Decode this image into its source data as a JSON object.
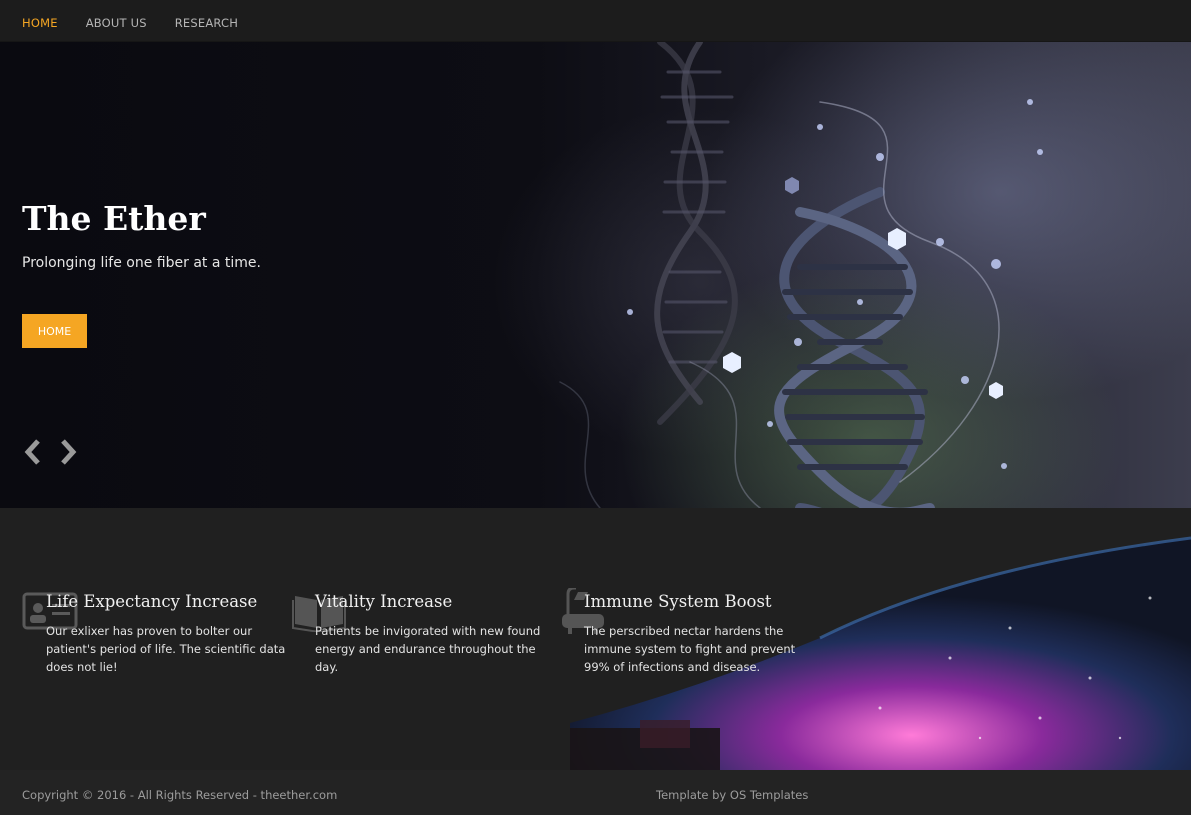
{
  "nav": {
    "items": [
      {
        "label": "HOME"
      },
      {
        "label": "ABOUT US"
      },
      {
        "label": "RESEARCH"
      }
    ]
  },
  "hero": {
    "title": "The Ether",
    "subtitle": "Prolonging life one fiber at a time.",
    "button_label": "HOME",
    "prev_icon": "chevron-left-icon",
    "next_icon": "chevron-right-icon"
  },
  "features": [
    {
      "icon": "id-card-icon",
      "title": "Life Expectancy Increase",
      "text": "Our exlixer has proven to bolter our patient's period of life. The scientific data does not lie!"
    },
    {
      "icon": "open-book-icon",
      "title": "Vitality Increase",
      "text": "Patients be invigorated with new found energy and endurance throughout the day."
    },
    {
      "icon": "bathtub-shower-icon",
      "title": "Immune System Boost",
      "text": "The perscribed nectar hardens the immune system to fight and prevent 99% of infections and disease."
    }
  ],
  "footer": {
    "copyright": "Copyright © 2016 - All Rights Reserved - theether.com",
    "credit": "Template by OS Templates"
  },
  "colors": {
    "accent": "#f5a623",
    "nav_bg": "#1c1c1c",
    "footer_bg": "#232323",
    "features_bg": "#202020"
  }
}
